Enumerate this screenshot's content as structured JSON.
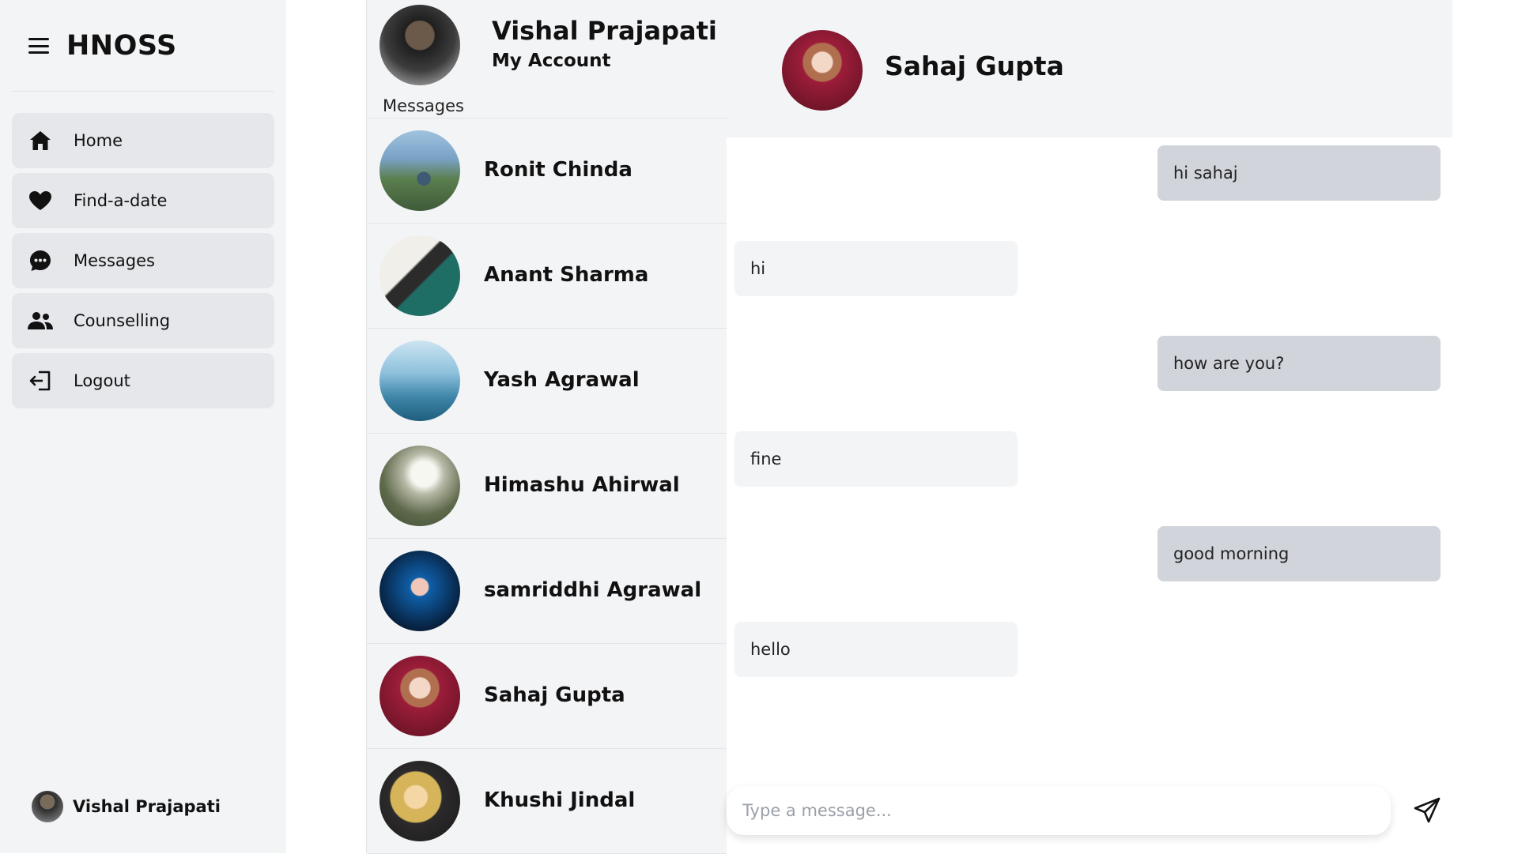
{
  "brand": {
    "name": "HNOSS",
    "menu_icon": "hamburger-icon"
  },
  "sidebar": {
    "items": [
      {
        "label": "Home",
        "icon": "home-icon"
      },
      {
        "label": "Find-a-date",
        "icon": "heart-icon"
      },
      {
        "label": "Messages",
        "icon": "chat-bubble-icon"
      },
      {
        "label": "Counselling",
        "icon": "people-icon"
      },
      {
        "label": "Logout",
        "icon": "logout-icon"
      }
    ],
    "user": {
      "name": "Vishal Prajapati"
    }
  },
  "account": {
    "name": "Vishal Prajapati",
    "subtitle": "My Account",
    "section_label": "Messages"
  },
  "contacts": [
    {
      "name": "Ronit Chinda"
    },
    {
      "name": "Anant Sharma"
    },
    {
      "name": "Yash Agrawal"
    },
    {
      "name": "Himashu Ahirwal"
    },
    {
      "name": "samriddhi Agrawal"
    },
    {
      "name": "Sahaj Gupta"
    },
    {
      "name": "Khushi Jindal"
    }
  ],
  "chat": {
    "title": "Sahaj Gupta",
    "messages": [
      {
        "text": "hi sahaj",
        "direction": "outgoing"
      },
      {
        "text": "hi",
        "direction": "incoming"
      },
      {
        "text": "how are you?",
        "direction": "outgoing"
      },
      {
        "text": "fine",
        "direction": "incoming"
      },
      {
        "text": "good morning",
        "direction": "outgoing"
      },
      {
        "text": "hello",
        "direction": "incoming"
      }
    ],
    "input": {
      "value": "",
      "placeholder": "Type a message..."
    },
    "send_icon": "send-icon"
  },
  "colors": {
    "panel_bg": "#f3f4f6",
    "nav_item_bg": "#e5e7eb",
    "outgoing_bubble": "#d1d5db",
    "incoming_bubble": "#f3f4f6",
    "text": "#111111"
  }
}
